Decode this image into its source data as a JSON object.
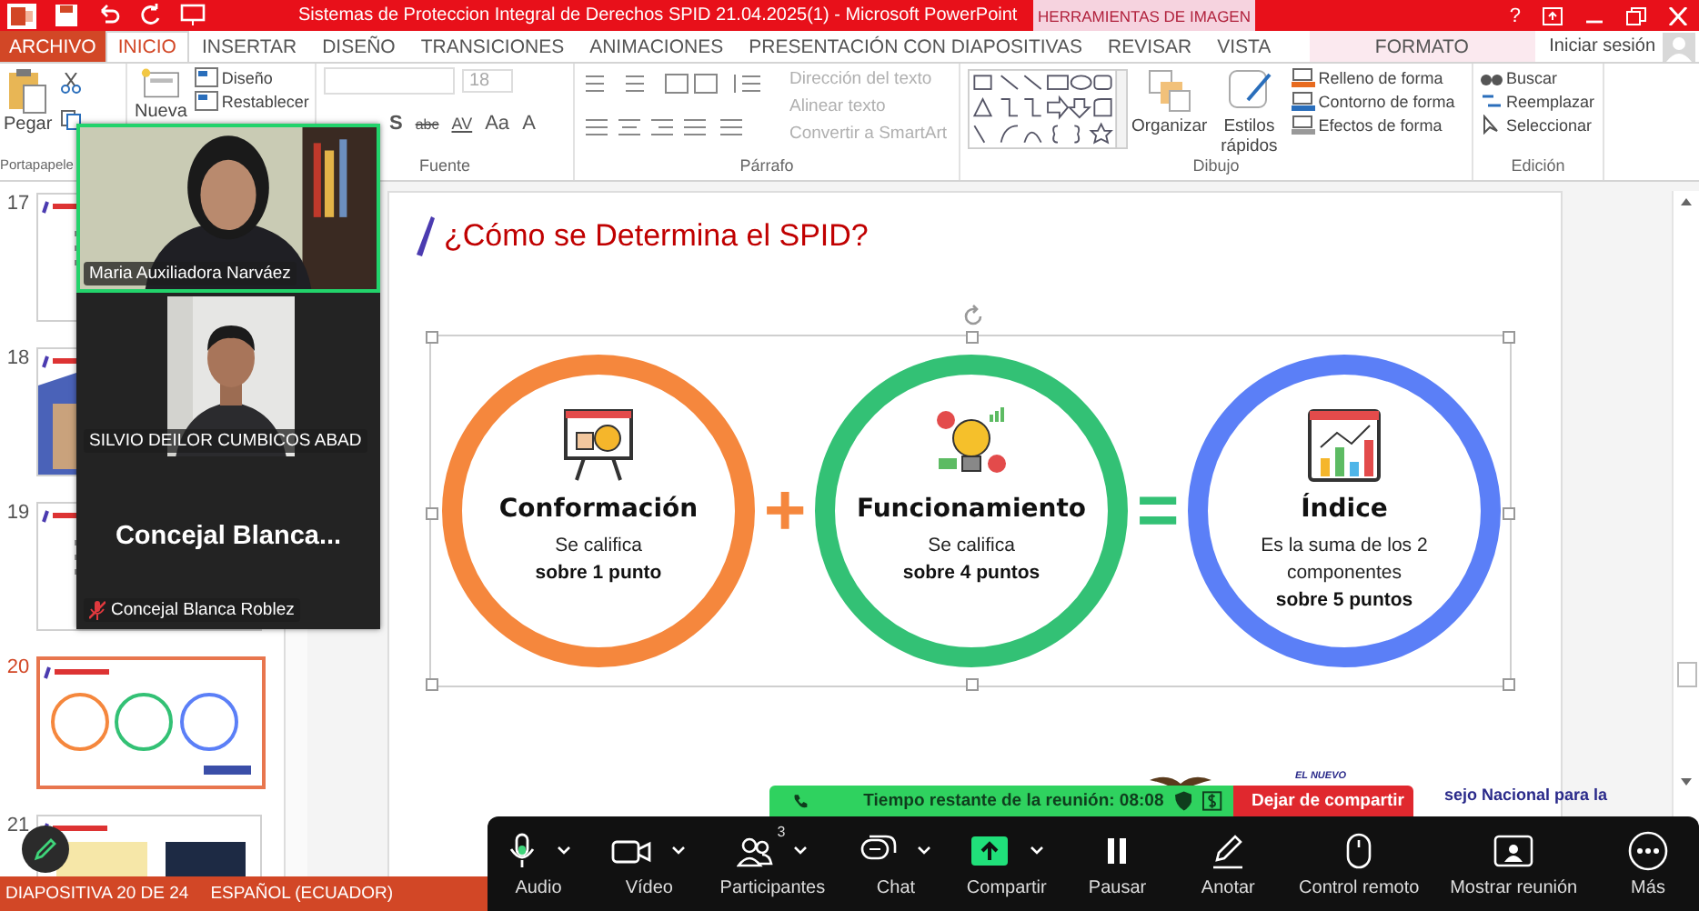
{
  "title_bar": {
    "title": "Sistemas de Proteccion Integral de Derechos SPID 21.04.2025(1) -  Microsoft PowerPoint",
    "context_label": "HERRAMIENTAS DE IMAGEN",
    "help": "?"
  },
  "tabs": [
    {
      "label": "ARCHIVO",
      "kind": "file",
      "selected": false
    },
    {
      "label": "INICIO",
      "kind": "tab",
      "selected": true
    },
    {
      "label": "INSERTAR",
      "kind": "tab",
      "selected": false
    },
    {
      "label": "DISEÑO",
      "kind": "tab",
      "selected": false
    },
    {
      "label": "TRANSICIONES",
      "kind": "tab",
      "selected": false
    },
    {
      "label": "ANIMACIONES",
      "kind": "tab",
      "selected": false
    },
    {
      "label": "PRESENTACIÓN CON DIAPOSITIVAS",
      "kind": "tab",
      "selected": false
    },
    {
      "label": "REVISAR",
      "kind": "tab",
      "selected": false
    },
    {
      "label": "VISTA",
      "kind": "tab",
      "selected": false
    },
    {
      "label": "FORMATO",
      "kind": "context",
      "selected": false
    }
  ],
  "account": "Iniciar sesión",
  "ribbon": {
    "clipboard": {
      "label": "Portapapele",
      "paste": "Pegar"
    },
    "slides": {
      "new": "Nueva",
      "items": [
        "Diseño",
        "Restablecer"
      ]
    },
    "font": {
      "label": "Fuente",
      "size": "18",
      "buttons": [
        "S",
        "abc",
        "AV",
        "Aa",
        "A"
      ]
    },
    "paragraph": {
      "label": "Párrafo",
      "items": [
        {
          "label": "Dirección del texto",
          "disabled": true
        },
        {
          "label": "Alinear texto",
          "disabled": true
        },
        {
          "label": "Convertir a SmartArt",
          "disabled": true
        }
      ]
    },
    "drawing": {
      "label": "Dibujo",
      "arrange": "Organizar",
      "quick_styles": "Estilos rápidos",
      "items": [
        "Relleno de forma",
        "Contorno de forma",
        "Efectos de forma"
      ]
    },
    "editing": {
      "label": "Edición",
      "items": [
        "Buscar",
        "Reemplazar",
        "Seleccionar"
      ]
    }
  },
  "thumbnails": [
    {
      "number": "17",
      "selected": false
    },
    {
      "number": "18",
      "selected": false
    },
    {
      "number": "19",
      "selected": false
    },
    {
      "number": "20",
      "selected": true
    },
    {
      "number": "21",
      "selected": false
    }
  ],
  "slide": {
    "title": "¿Cómo se Determina el SPID?",
    "components": [
      {
        "title": "Conformación",
        "text": "Se califica",
        "score": "sobre 1 punto",
        "color": "#f5873d"
      },
      {
        "title": "Funcionamiento",
        "text": "Se califica",
        "score": "sobre 4 puntos",
        "color": "#33c175"
      },
      {
        "title": "Índice",
        "text": "Es la suma de los 2 componentes",
        "score": "sobre 5 puntos",
        "color": "#5b7ff7"
      }
    ],
    "operators": [
      "+",
      "="
    ],
    "footer": [
      "EL NUEVO",
      "sejo Nacional para la"
    ]
  },
  "meeting": {
    "participants": [
      {
        "name": "Maria Auxiliadora Narváez",
        "kind": "video",
        "speaking": true,
        "muted": false
      },
      {
        "name": "SILVIO DEILOR CUMBICOS ABAD",
        "kind": "video",
        "speaking": false,
        "muted": false
      },
      {
        "name": "Concejal Blanca Roblez",
        "kind": "no_video",
        "display": "Concejal  Blanca...",
        "speaking": false,
        "muted": true
      }
    ],
    "timer": "Tiempo restante de la reunión: 08:08",
    "stop_share": "Dejar de compartir",
    "toolbar": [
      {
        "label": "Audio",
        "kind": "audio",
        "caret": true
      },
      {
        "label": "Vídeo",
        "kind": "video",
        "caret": true
      },
      {
        "label": "Participantes",
        "kind": "participants",
        "caret": true,
        "count": "3"
      },
      {
        "label": "Chat",
        "kind": "chat",
        "caret": true
      },
      {
        "label": "Compartir",
        "kind": "share",
        "caret": true
      },
      {
        "label": "Pausar",
        "kind": "pause",
        "caret": false
      },
      {
        "label": "Anotar",
        "kind": "annotate",
        "caret": false
      },
      {
        "label": "Control remoto",
        "kind": "remote",
        "caret": false
      },
      {
        "label": "Mostrar reunión",
        "kind": "show",
        "caret": false
      },
      {
        "label": "Más",
        "kind": "more",
        "caret": false
      }
    ]
  },
  "status_bar": [
    "DIAPOSITIVA 20 DE 24",
    "ESPAÑOL (ECUADOR)"
  ]
}
